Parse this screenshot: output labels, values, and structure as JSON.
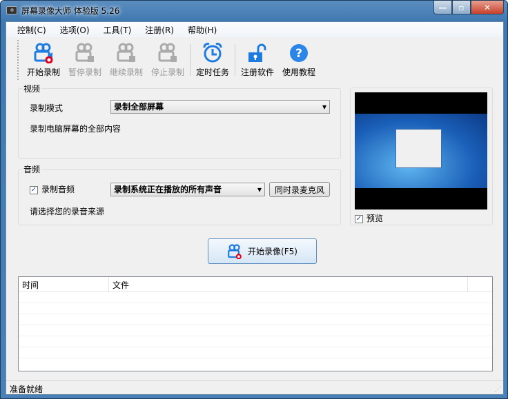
{
  "window": {
    "title": "屏幕录像大师 体验版 5.26"
  },
  "menu": [
    "控制(C)",
    "选项(O)",
    "工具(T)",
    "注册(R)",
    "帮助(H)"
  ],
  "toolbar": [
    {
      "label": "开始录制",
      "icon": "camera-record-icon",
      "enabled": true
    },
    {
      "label": "暂停录制",
      "icon": "camera-pause-icon",
      "enabled": false
    },
    {
      "label": "继续录制",
      "icon": "camera-resume-icon",
      "enabled": false
    },
    {
      "label": "停止录制",
      "icon": "camera-stop-icon",
      "enabled": false
    },
    {
      "label": "定时任务",
      "icon": "alarm-clock-icon",
      "enabled": true
    },
    {
      "label": "注册软件",
      "icon": "unlock-icon",
      "enabled": true
    },
    {
      "label": "使用教程",
      "icon": "help-icon",
      "enabled": true
    }
  ],
  "video": {
    "group": "视频",
    "mode_label": "录制模式",
    "mode_value": "录制全部屏幕",
    "desc": "录制电脑屏幕的全部内容"
  },
  "audio": {
    "group": "音频",
    "record_label": "录制音频",
    "checked": true,
    "source_value": "录制系统正在播放的所有声音",
    "mic_button": "同时录麦克风",
    "desc": "请选择您的录音来源"
  },
  "preview": {
    "label": "预览",
    "checked": true
  },
  "start_button": "开始录像(F5)",
  "table": {
    "columns": [
      "时间",
      "文件"
    ],
    "rows": []
  },
  "status": "准备就绪",
  "colors": {
    "accent": "#1e7be0",
    "record": "#e0001b"
  }
}
